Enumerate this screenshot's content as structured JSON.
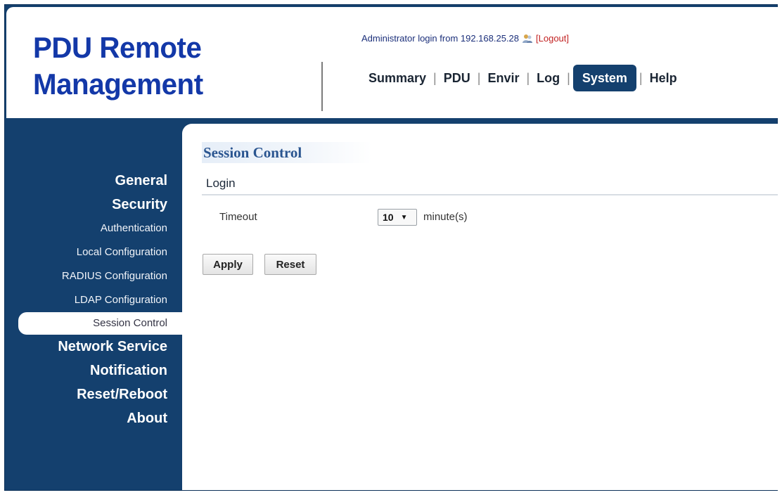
{
  "header": {
    "logo_line1": "PDU Remote",
    "logo_line2": "Management",
    "admin_text": "Administrator login from 192.168.25.28",
    "logout_label": "[Logout]"
  },
  "topnav": {
    "items": [
      "Summary",
      "PDU",
      "Envir",
      "Log",
      "System",
      "Help"
    ],
    "active": "System"
  },
  "sidebar": {
    "items": [
      {
        "label": "General",
        "level": "main"
      },
      {
        "label": "Security",
        "level": "main"
      },
      {
        "label": "Authentication",
        "level": "sub"
      },
      {
        "label": "Local Configuration",
        "level": "sub"
      },
      {
        "label": "RADIUS Configuration",
        "level": "sub"
      },
      {
        "label": "LDAP Configuration",
        "level": "sub"
      },
      {
        "label": "Session Control",
        "level": "sub",
        "active": true
      },
      {
        "label": "Network Service",
        "level": "main"
      },
      {
        "label": "Notification",
        "level": "main"
      },
      {
        "label": "Reset/Reboot",
        "level": "main"
      },
      {
        "label": "About",
        "level": "main"
      }
    ]
  },
  "main": {
    "title": "Session Control",
    "section": "Login",
    "timeout_label": "Timeout",
    "timeout_value": "10",
    "timeout_unit": "minute(s)",
    "apply_label": "Apply",
    "reset_label": "Reset"
  },
  "colors": {
    "navy": "#14406e",
    "logo_blue": "#1338a8",
    "logout_red": "#c22222",
    "title_blue": "#2a5590"
  },
  "icons": {
    "user": "user-icon",
    "dropdown": "chevron-down-icon"
  }
}
